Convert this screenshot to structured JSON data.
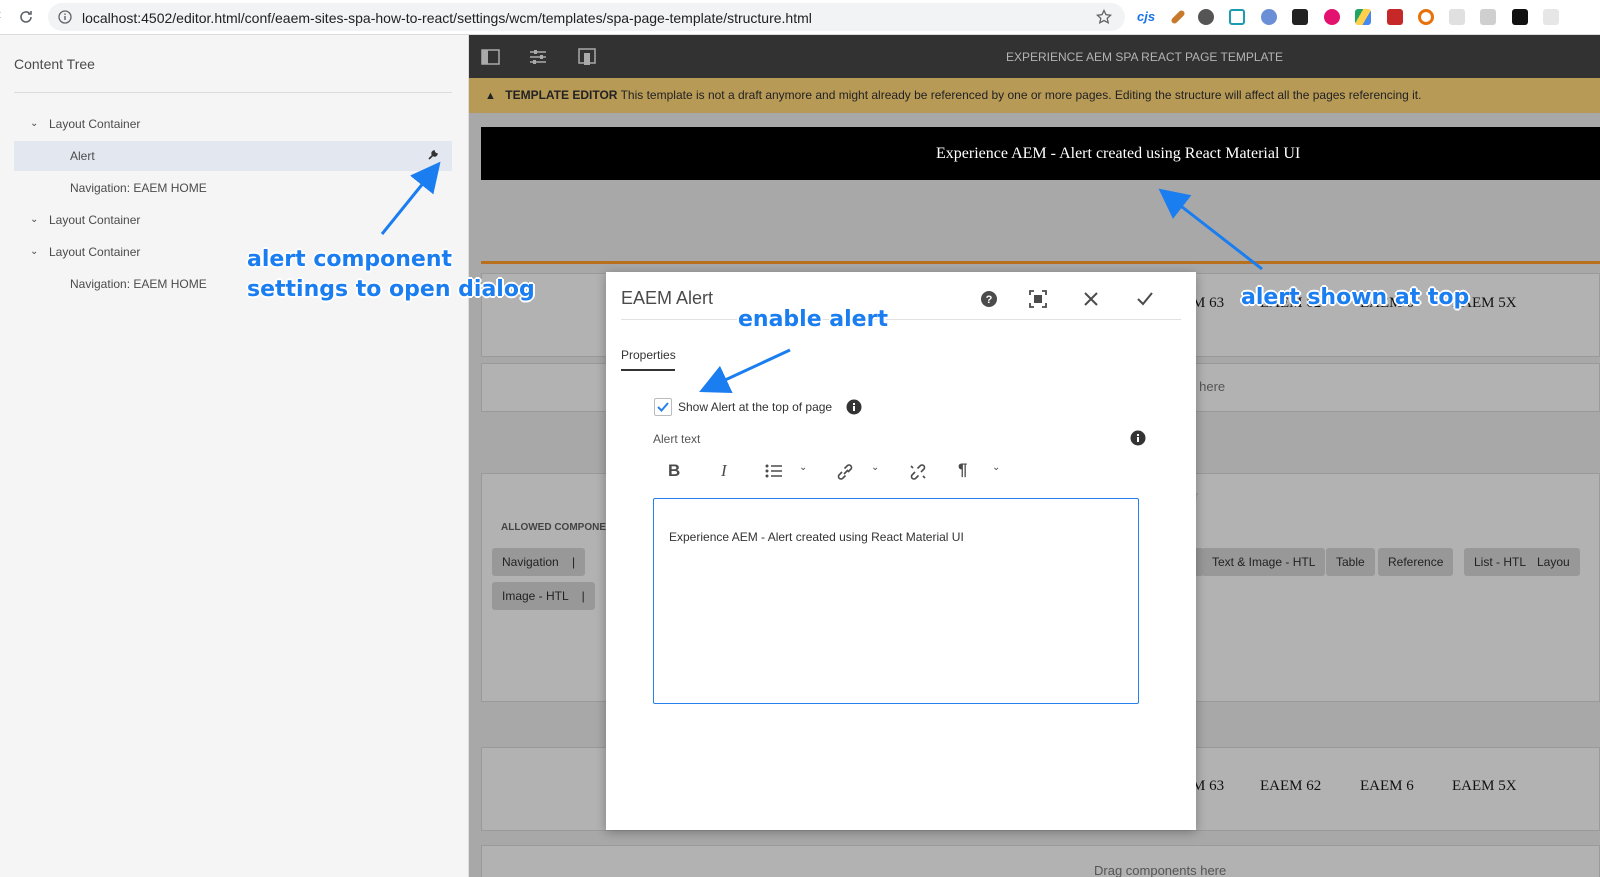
{
  "browser": {
    "url": "localhost:4502/editor.html/conf/eaem-sites-spa-how-to-react/settings/wcm/templates/spa-page-template/structure.html",
    "extensions": [
      "cjs"
    ]
  },
  "sidebar": {
    "title": "Content Tree",
    "items": [
      {
        "label": "Layout Container"
      },
      {
        "label": "Alert"
      },
      {
        "label": "Navigation: EAEM HOME"
      },
      {
        "label": "Layout Container"
      },
      {
        "label": "Layout Container"
      },
      {
        "label": "Navigation: EAEM HOME"
      }
    ]
  },
  "editor": {
    "title": "EXPERIENCE AEM SPA REACT PAGE TEMPLATE",
    "warning_label": "TEMPLATE EDITOR",
    "warning_text": "This template is not a draft anymore and might already be referenced by one or more pages. Editing the structure will affect all the pages referencing it.",
    "alert_text": "Experience AEM - Alert created using React Material UI",
    "nav_items": [
      "M 63",
      "EAEM 62",
      "EAEM 6",
      "EAEM 5X"
    ],
    "drag_partial": "s here",
    "layout_partial": "ner",
    "allowed_label": "ALLOWED COMPONEN",
    "chips_row1": [
      "Navigation",
      "Text & Image - HTL",
      "Table",
      "Reference",
      "List - HTL",
      "Layou"
    ],
    "chips_row2": [
      "Image - HTL"
    ],
    "nav_items2": [
      "M 63",
      "EAEM 62",
      "EAEM 6",
      "EAEM 5X"
    ],
    "drag_text": "Drag components here"
  },
  "dialog": {
    "title": "EAEM Alert",
    "tab": "Properties",
    "checkbox_label": "Show Alert at the top of page",
    "checkbox_checked": true,
    "field_label": "Alert text",
    "rte_value": "Experience AEM - Alert created using React Material UI"
  },
  "annotations": {
    "settings": [
      "alert  component",
      "settings to open dialog"
    ],
    "enable": "enable alert",
    "shown": "alert shown at top"
  },
  "colors": {
    "accent": "#1a7df0",
    "warning": "#b89a57",
    "toolbar": "#323232",
    "checkbox": "#2680eb"
  }
}
